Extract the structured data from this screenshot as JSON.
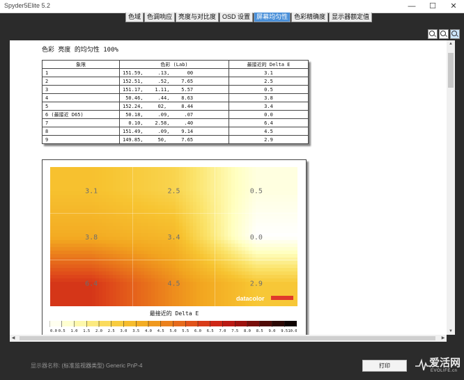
{
  "window": {
    "title": "Spyder5Elite 5.2",
    "minimize_glyph": "—",
    "maximize_glyph": "☐",
    "close_glyph": "✕"
  },
  "tabs": [
    {
      "label": "色域",
      "active": false
    },
    {
      "label": "色调响应",
      "active": false
    },
    {
      "label": "亮度与对比度",
      "active": false
    },
    {
      "label": "OSD 设置",
      "active": false
    },
    {
      "label": "屏幕均匀性",
      "active": true
    },
    {
      "label": "色彩精确度",
      "active": false
    },
    {
      "label": "显示器额定值",
      "active": false
    }
  ],
  "zoom_icons": [
    "zoom-in-icon",
    "zoom-out-icon",
    "zoom-fit-icon"
  ],
  "report": {
    "title": "色彩 亮度 的均匀性 100%",
    "table": {
      "headers": [
        "象限",
        "色彩 (Lab)",
        "最接近的 Delta E"
      ],
      "rows": [
        {
          "quadrant": "1",
          "lab": "151.59,     .13,      00",
          "delta": "3.1"
        },
        {
          "quadrant": "2",
          "lab": "152.51,     .52,    7.65",
          "delta": "2.5"
        },
        {
          "quadrant": "3",
          "lab": "151.17,    1.11,    5.57",
          "delta": "0.5"
        },
        {
          "quadrant": "4",
          "lab": " 50.46,     .44,    8.63",
          "delta": "3.8"
        },
        {
          "quadrant": "5",
          "lab": "152.24,     02,     8.44",
          "delta": "3.4"
        },
        {
          "quadrant": "6 (最接近 D65)",
          "lab": " 50.18,     .09,     .07",
          "delta": "0.0"
        },
        {
          "quadrant": "7",
          "lab": "  0.10,    2.58,     .40",
          "delta": "6.4"
        },
        {
          "quadrant": "8",
          "lab": "151.49,     .09,    9.14",
          "delta": "4.5"
        },
        {
          "quadrant": "9",
          "lab": "149.85,     50,     7.65",
          "delta": "2.9"
        }
      ]
    }
  },
  "chart_data": {
    "type": "heatmap",
    "rows": 3,
    "cols": 3,
    "values": [
      [
        3.1,
        2.5,
        0.5
      ],
      [
        3.8,
        3.4,
        0.0
      ],
      [
        6.4,
        4.5,
        2.9
      ]
    ],
    "labels": [
      [
        "3.1",
        "2.5",
        "0.5"
      ],
      [
        "3.8",
        "3.4",
        "0.0"
      ],
      [
        "6.4",
        "4.5",
        "2.9"
      ]
    ],
    "legend_title": "最接近的 Delta E",
    "legend_ticks": [
      "0.0",
      "0.5",
      "1.0",
      "1.5",
      "2.0",
      "2.5",
      "3.0",
      "3.5",
      "4.0",
      "4.5",
      "5.0",
      "5.5",
      "6.0",
      "6.5",
      "7.0",
      "7.5",
      "8.0",
      "8.5",
      "9.0",
      "9.5",
      "10.0"
    ],
    "color_stops": [
      "#ffffff",
      "#ffffc0",
      "#fbe36a",
      "#f7c431",
      "#f2a51f",
      "#e9751b",
      "#de471a",
      "#c81c15",
      "#8e0f0b",
      "#3a0a05",
      "#000000"
    ],
    "logo_text": "datacolor",
    "logo_bar_color": "#e03a2b"
  },
  "footer": {
    "display_name_label": "显示器名称:",
    "display_name_value": "(标准监视器类型) Generic PnP-4",
    "print_label": "打印"
  },
  "watermark": {
    "main": "爱活网",
    "sub": "EVOLIFE.cn"
  }
}
